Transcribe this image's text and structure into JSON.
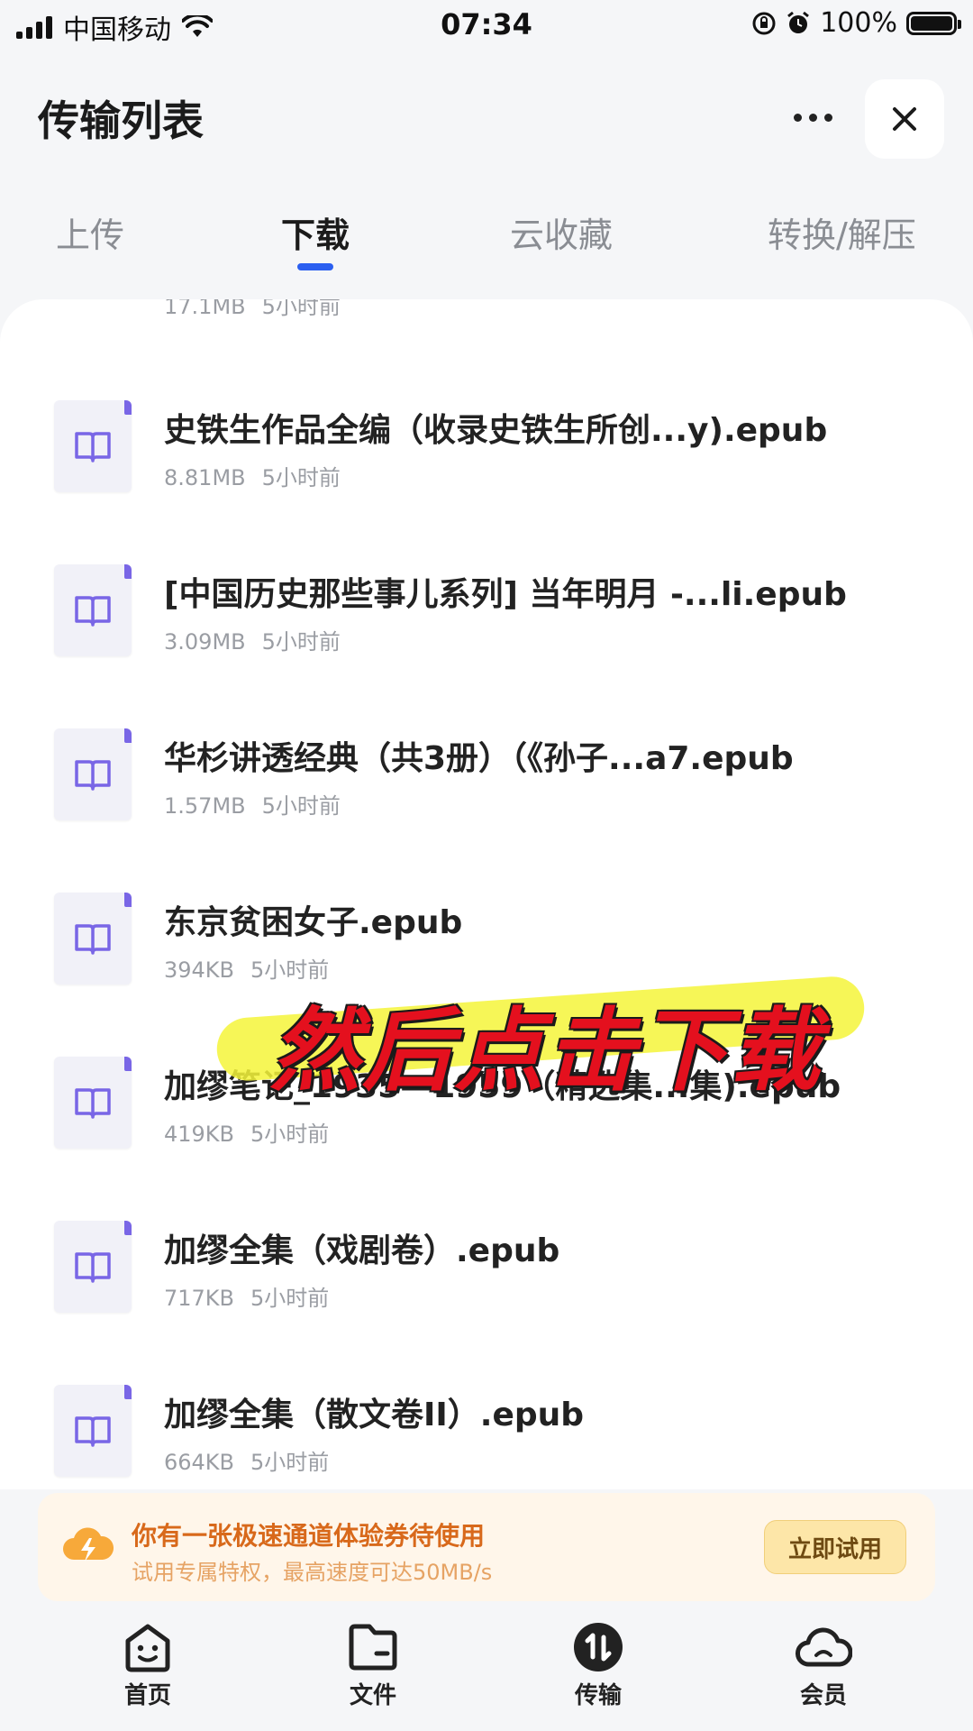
{
  "status_bar": {
    "carrier": "中国移动",
    "time": "07:34",
    "battery": "100%"
  },
  "header": {
    "title": "传输列表"
  },
  "tabs": [
    {
      "label": "上传",
      "active": false
    },
    {
      "label": "下载",
      "active": true
    },
    {
      "label": "云收藏",
      "active": false
    },
    {
      "label": "转换/解压",
      "active": false
    }
  ],
  "downloads": [
    {
      "name": "",
      "size": "17.1MB",
      "time": "5小时前"
    },
    {
      "name": "史铁生作品全编（收录史铁生所创...y).epub",
      "size": "8.81MB",
      "time": "5小时前"
    },
    {
      "name": "[中国历史那些事儿系列] 当年明月 -...li.epub",
      "size": "3.09MB",
      "time": "5小时前"
    },
    {
      "name": "华杉讲透经典（共3册）（《孙子...a7.epub",
      "size": "1.57MB",
      "time": "5小时前"
    },
    {
      "name": "东京贫困女子.epub",
      "size": "394KB",
      "time": "5小时前"
    },
    {
      "name": "加缪笔记_1935—1959（精选集...集).epub",
      "size": "419KB",
      "time": "5小时前"
    },
    {
      "name": "加缪全集（戏剧卷）.epub",
      "size": "717KB",
      "time": "5小时前"
    },
    {
      "name": "加缪全集（散文卷II）.epub",
      "size": "664KB",
      "time": "5小时前"
    }
  ],
  "overlay_caption": "然后点击下载",
  "promo": {
    "title": "你有一张极速通道体验券待使用",
    "subtitle": "试用专属特权，最高速度可达50MB/s",
    "button": "立即试用"
  },
  "bottom_nav": [
    {
      "label": "首页",
      "icon": "home-smile-icon"
    },
    {
      "label": "文件",
      "icon": "folder-icon"
    },
    {
      "label": "传输",
      "icon": "transfer-icon"
    },
    {
      "label": "会员",
      "icon": "cloud-member-icon"
    }
  ],
  "colors": {
    "accent": "#2b5ff0",
    "file_corner": "#7966e6",
    "promo_text": "#d8691b",
    "overlay_text": "#e4101e"
  }
}
